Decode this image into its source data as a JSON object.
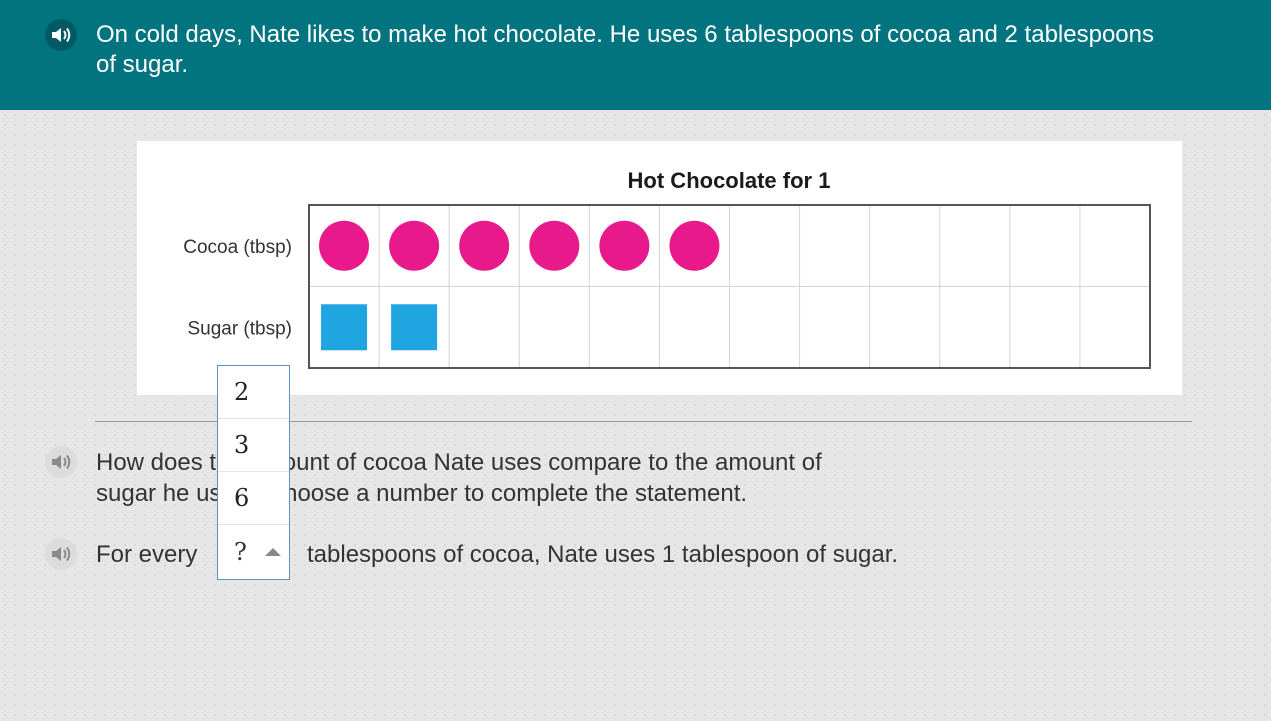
{
  "header": {
    "text": "On cold days, Nate likes to make hot chocolate. He uses 6 tablespoons of cocoa and 2 tablespoons of sugar."
  },
  "icons": {
    "audio": "speaker-icon"
  },
  "colors": {
    "header_bg": "#027480",
    "cocoa": "#e8198b",
    "sugar": "#1fa6e0",
    "dropdown_border": "#5a8fc8"
  },
  "chart_data": {
    "type": "table",
    "title": "Hot Chocolate for 1",
    "columns": 12,
    "rows": [
      {
        "label": "Cocoa (tbsp)",
        "count": 6,
        "shape": "circle"
      },
      {
        "label": "Sugar (tbsp)",
        "count": 2,
        "shape": "square"
      }
    ]
  },
  "question": {
    "prompt_visible": "How does",
    "prompt_full_line1": "How does the amount of cocoa Nate uses compare to the amount of",
    "prompt_full_line2": "sugar he uses? Choose a number to complete the statement.",
    "statement_pre": "For every",
    "statement_post": "tablespoons of cocoa, Nate uses 1 tablespoon of sugar."
  },
  "dropdown": {
    "options": [
      "2",
      "3",
      "6"
    ],
    "selected": "?"
  }
}
